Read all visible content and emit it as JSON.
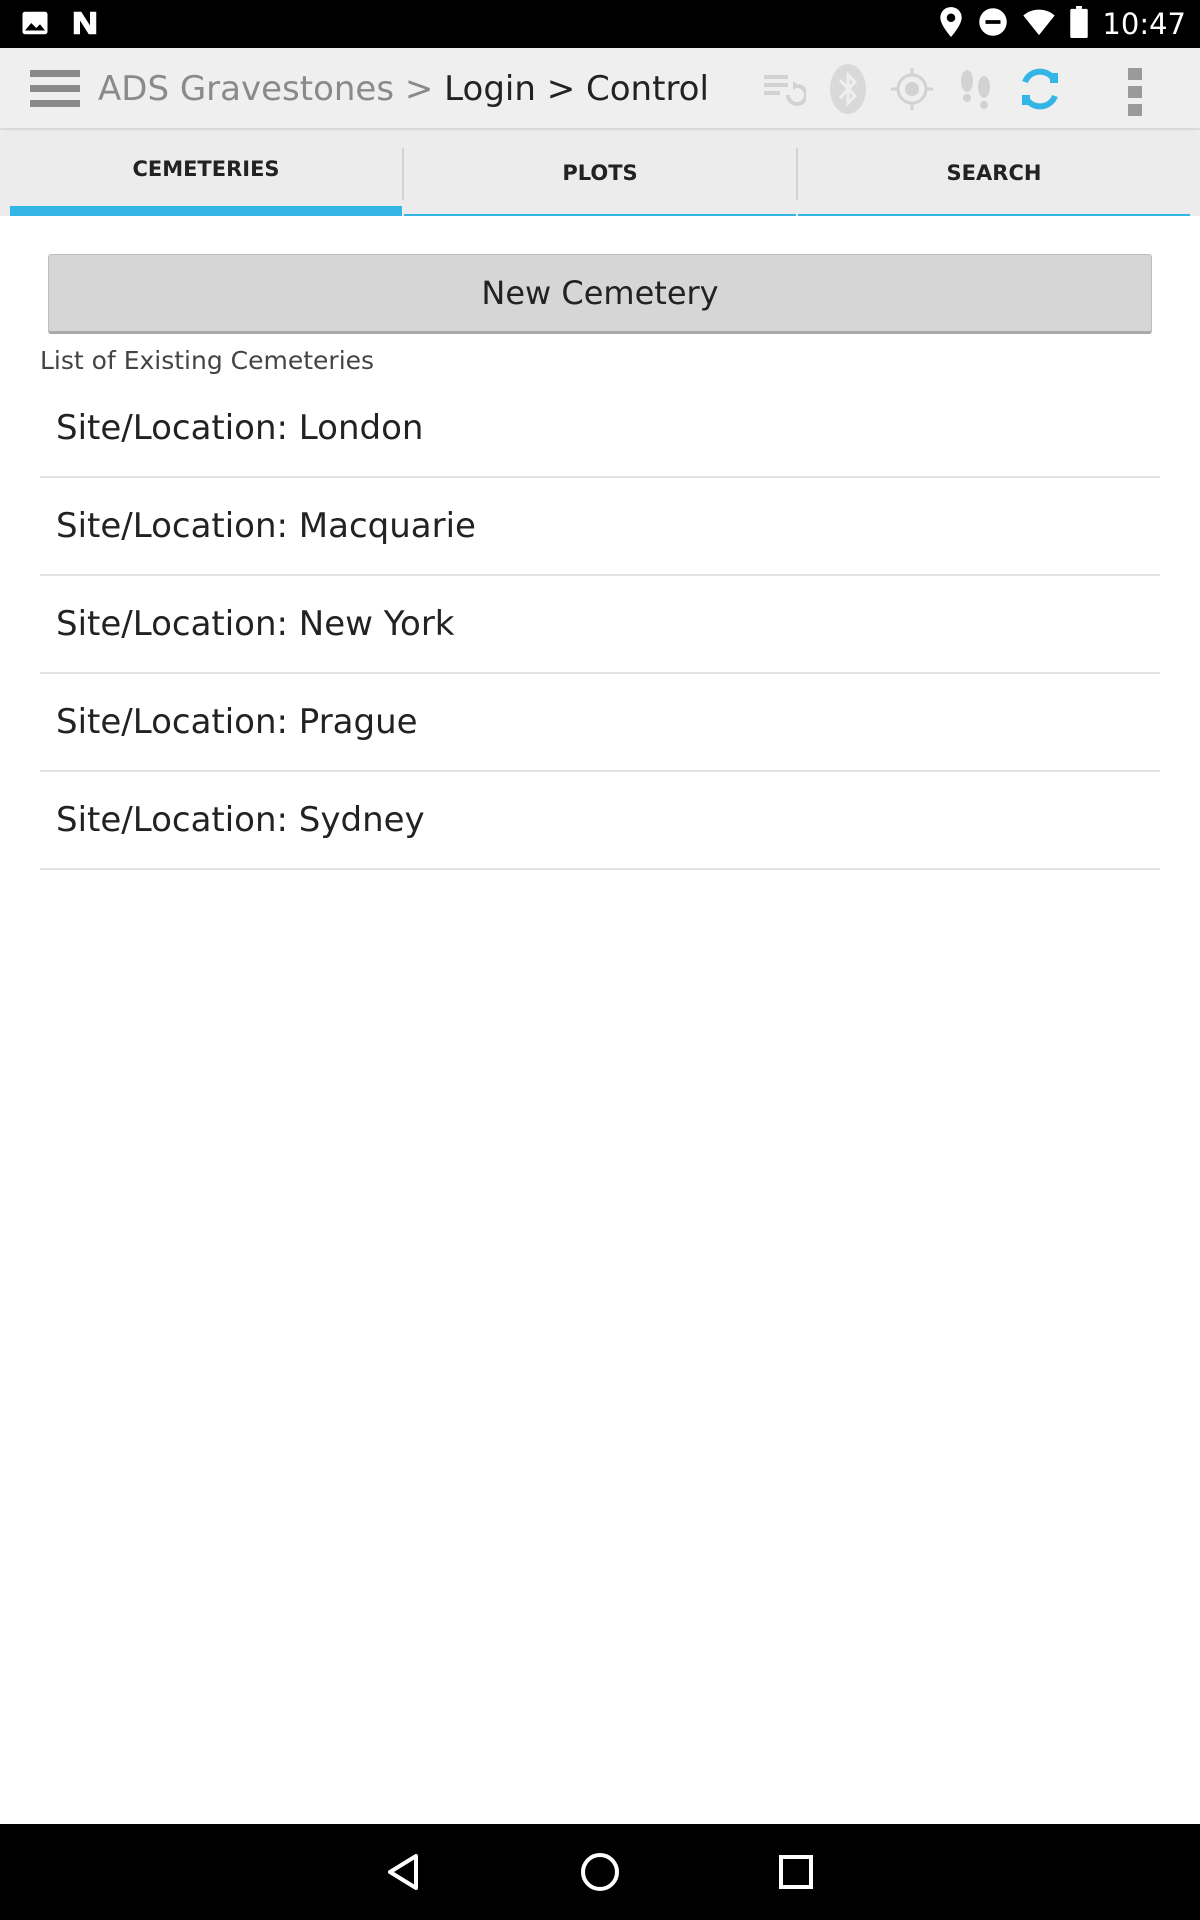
{
  "status_bar": {
    "time": "10:47",
    "left_icons": [
      "image-icon",
      "n-notification-icon"
    ],
    "right_icons": [
      "location-pin-icon",
      "do-not-disturb-icon",
      "wifi-icon",
      "battery-icon"
    ]
  },
  "action_bar": {
    "breadcrumb": {
      "app": "ADS Gravestones",
      "separator_1": " > ",
      "step_1": "Login",
      "separator_2": " > ",
      "step_2": "Control"
    },
    "icons": [
      "sync-list-icon",
      "bluetooth-icon",
      "gps-target-icon",
      "footprints-icon",
      "refresh-icon",
      "overflow-menu-icon"
    ],
    "accent_color": "#33b5e5"
  },
  "tabs": [
    {
      "label": "CEMETERIES",
      "active": true
    },
    {
      "label": "PLOTS",
      "active": false
    },
    {
      "label": "SEARCH",
      "active": false
    }
  ],
  "content": {
    "new_button_label": "New Cemetery",
    "list_caption": "List of Existing Cemeteries",
    "items": [
      {
        "label": "Site/Location: London"
      },
      {
        "label": "Site/Location: Macquarie"
      },
      {
        "label": "Site/Location: New York"
      },
      {
        "label": "Site/Location: Prague"
      },
      {
        "label": "Site/Location: Sydney"
      }
    ]
  },
  "nav_bar": {
    "buttons": [
      "back-icon",
      "home-icon",
      "recents-icon"
    ]
  }
}
